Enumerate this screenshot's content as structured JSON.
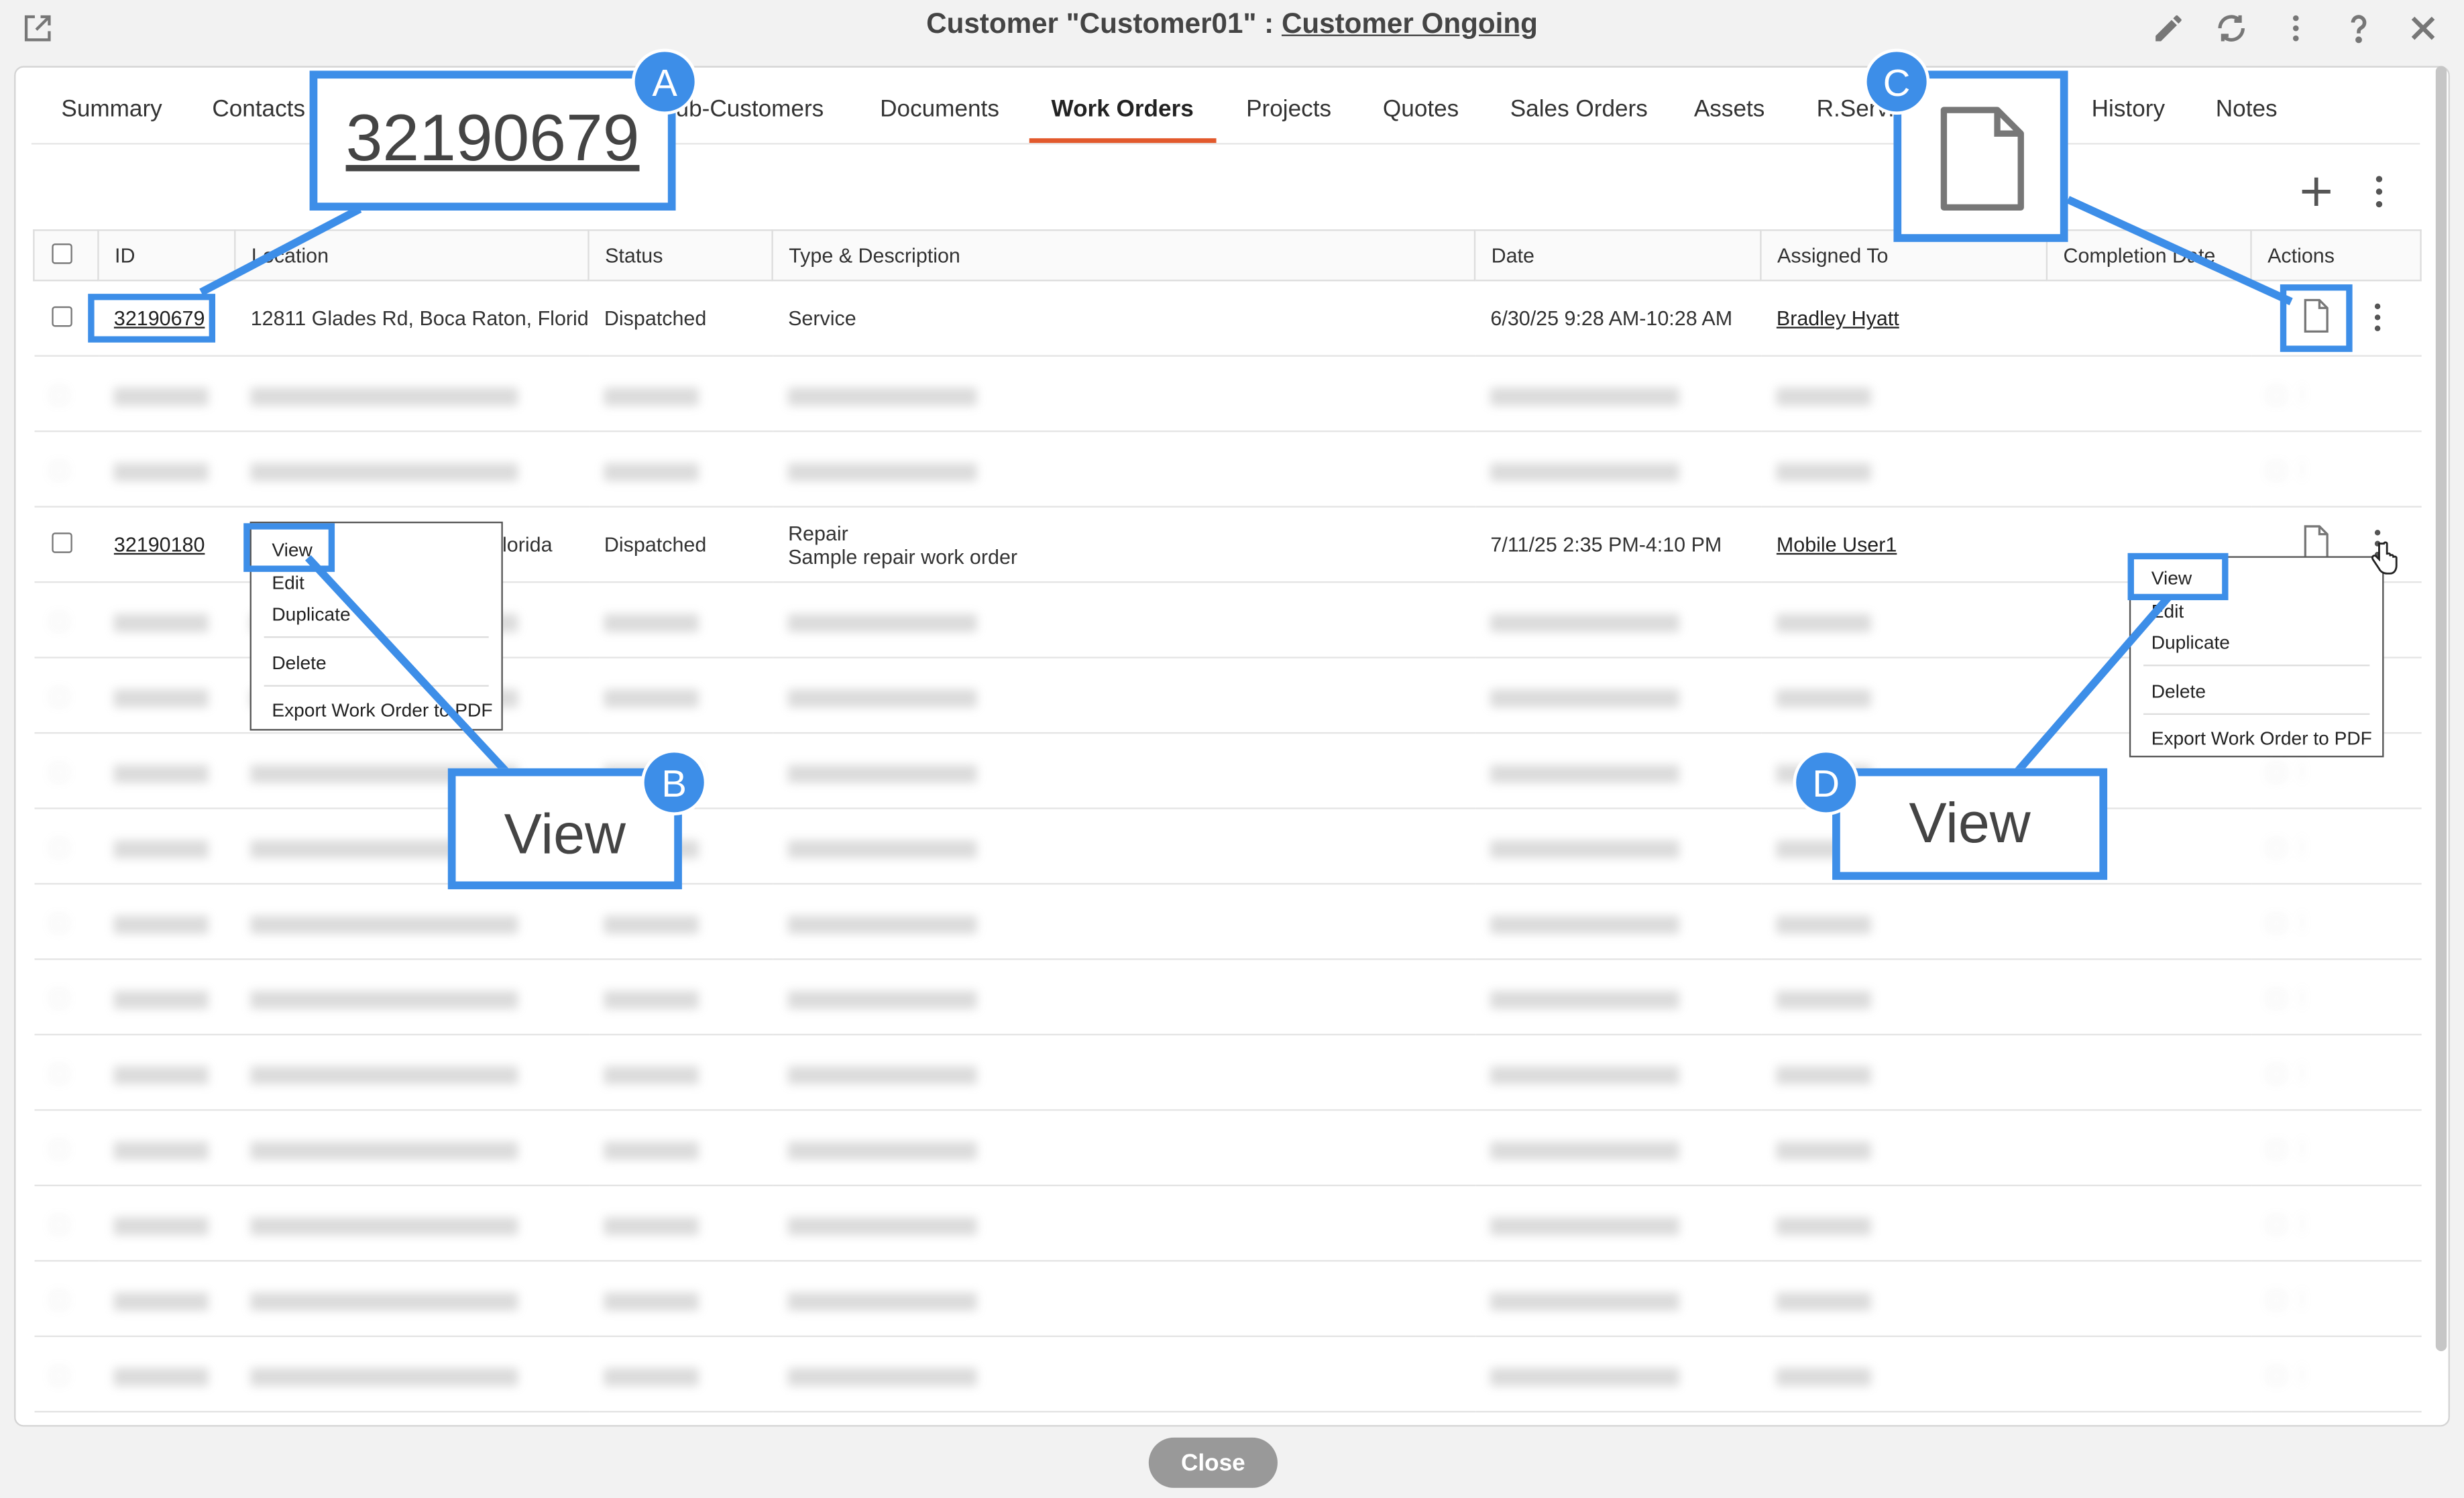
{
  "window": {
    "title_prefix": "Customer  \"Customer01\" : ",
    "title_link": "Customer Ongoing"
  },
  "tabs": [
    "Summary",
    "Contacts",
    "Sub-Customers",
    "Documents",
    "Work Orders",
    "Projects",
    "Quotes",
    "Sales Orders",
    "Assets",
    "R.Servi",
    "History",
    "Notes"
  ],
  "active_tab": "Work Orders",
  "table": {
    "columns": [
      "ID",
      "Location",
      "Status",
      "Type & Description",
      "Date",
      "Assigned To",
      "Completion Date",
      "Actions"
    ],
    "rows": [
      {
        "id": "32190679",
        "location": "12811 Glades Rd, Boca Raton, Florida",
        "status": "Dispatched",
        "type": "Service",
        "description": "",
        "date": "6/30/25 9:28 AM-10:28 AM",
        "assigned": "Bradley Hyatt"
      },
      {
        "id": "32190180",
        "location": ", Florida",
        "status": "Dispatched",
        "type": "Repair",
        "description": "Sample repair work order",
        "date": "7/11/25 2:35 PM-4:10 PM",
        "assigned": "Mobile User1"
      }
    ]
  },
  "context_menu": {
    "items": [
      "View",
      "Edit",
      "Duplicate",
      "Delete",
      "Export Work Order to PDF"
    ]
  },
  "callouts": {
    "a": {
      "badge": "A",
      "text": "32190679"
    },
    "b": {
      "badge": "B",
      "text": "View"
    },
    "c": {
      "badge": "C"
    },
    "d": {
      "badge": "D",
      "text": "View"
    }
  },
  "footer": {
    "close_label": "Close"
  },
  "icons": {
    "popout": "external-link-icon",
    "edit": "pencil-icon",
    "refresh": "refresh-icon",
    "more": "kebab-icon",
    "help": "help-icon",
    "close": "close-icon",
    "add": "plus-icon",
    "document": "document-icon"
  },
  "colors": {
    "accent_tab": "#e2592c",
    "callout": "#3d8ee8",
    "close_button": "#999999"
  }
}
